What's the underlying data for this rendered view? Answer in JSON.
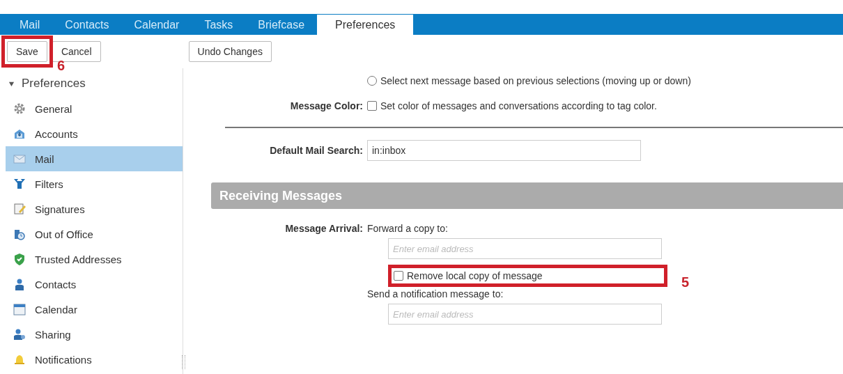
{
  "tabs": [
    {
      "label": "Mail",
      "selected": false
    },
    {
      "label": "Contacts",
      "selected": false
    },
    {
      "label": "Calendar",
      "selected": false
    },
    {
      "label": "Tasks",
      "selected": false
    },
    {
      "label": "Briefcase",
      "selected": false
    },
    {
      "label": "Preferences",
      "selected": true
    }
  ],
  "toolbar": {
    "left_buttons": [
      "Save",
      "Cancel"
    ],
    "undo_button": "Undo Changes"
  },
  "sidebar": {
    "header": "Preferences",
    "expanded": true,
    "items": [
      {
        "label": "General",
        "kind": "gear",
        "selected": false
      },
      {
        "label": "Accounts",
        "kind": "accounts",
        "selected": false
      },
      {
        "label": "Mail",
        "kind": "mail",
        "selected": true
      },
      {
        "label": "Filters",
        "kind": "filter",
        "selected": false
      },
      {
        "label": "Signatures",
        "kind": "signature",
        "selected": false
      },
      {
        "label": "Out of Office",
        "kind": "clock",
        "selected": false
      },
      {
        "label": "Trusted Addresses",
        "kind": "shield",
        "selected": false
      },
      {
        "label": "Contacts",
        "kind": "person",
        "selected": false
      },
      {
        "label": "Calendar",
        "kind": "calendar",
        "selected": false
      },
      {
        "label": "Sharing",
        "kind": "sharing",
        "selected": false
      },
      {
        "label": "Notifications",
        "kind": "bell",
        "selected": false
      }
    ]
  },
  "settings": {
    "select_next": {
      "label": "Select next message based on previous selections (moving up or down)",
      "selected": false
    },
    "message_color": {
      "label": "Message Color:",
      "option": "Set color of messages and conversations according to tag color.",
      "checked": false
    },
    "default_search": {
      "label": "Default Mail Search:",
      "value": "in:inbox"
    },
    "section_title": "Receiving Messages",
    "message_arrival": {
      "label": "Message Arrival:",
      "forward_label": "Forward a copy to:",
      "forward_placeholder": "Enter email address",
      "remove_local": {
        "label": "Remove local copy of message",
        "checked": false
      },
      "notify_label": "Send a notification message to:",
      "notify_placeholder": "Enter email address"
    }
  },
  "annotations": [
    {
      "number": "6"
    },
    {
      "number": "5"
    }
  ]
}
